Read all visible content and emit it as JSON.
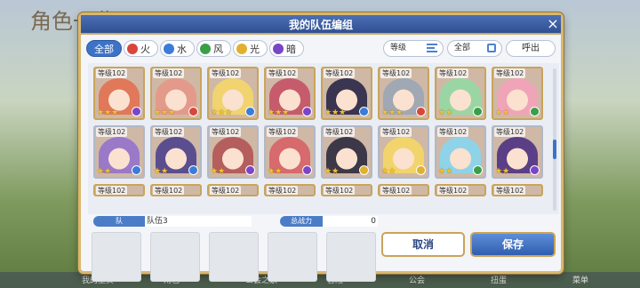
{
  "background": {
    "title": "角色一览",
    "bottom_nav": [
      "我的主页",
      "角色",
      "公会之家",
      "冒险",
      "公会",
      "扭蛋",
      "菜单"
    ]
  },
  "modal": {
    "title": "我的队伍编组",
    "close_symbol": "×"
  },
  "filters": {
    "elements": [
      {
        "label": "全部",
        "icon": "all",
        "color": "#3d73c7",
        "active": true
      },
      {
        "label": "火",
        "icon": "fire-icon",
        "color": "#d9463b",
        "active": false
      },
      {
        "label": "水",
        "icon": "water-icon",
        "color": "#3b7bd9",
        "active": false
      },
      {
        "label": "风",
        "icon": "wind-icon",
        "color": "#3a9f48",
        "active": false
      },
      {
        "label": "光",
        "icon": "light-icon",
        "color": "#e0b02f",
        "active": false
      },
      {
        "label": "暗",
        "icon": "dark-icon",
        "color": "#7b45c7",
        "active": false
      }
    ],
    "sort_label": "等级",
    "group_label": "全部",
    "call_label": "呼出"
  },
  "roster": {
    "rows": [
      [
        {
          "level": "等级102",
          "stars": "★★★",
          "elem_color": "#7b45c7",
          "hair": "#e1785a",
          "border": "gold"
        },
        {
          "level": "等级102",
          "stars": "★★★",
          "elem_color": "#d9463b",
          "hair": "#e39a8a",
          "border": "gold"
        },
        {
          "level": "等级102",
          "stars": "★★★",
          "elem_color": "#3b7bd9",
          "hair": "#f1d36f",
          "border": "gold"
        },
        {
          "level": "等级102",
          "stars": "★★★",
          "elem_color": "#7b45c7",
          "hair": "#c65c6b",
          "border": "gold"
        },
        {
          "level": "等级102",
          "stars": "★★★",
          "elem_color": "#3b7bd9",
          "hair": "#3a3550",
          "border": "gold"
        },
        {
          "level": "等级102",
          "stars": "★★★",
          "elem_color": "#d9463b",
          "hair": "#9fa8b3",
          "border": "gold"
        },
        {
          "level": "等级102",
          "stars": "★★",
          "elem_color": "#3a9f48",
          "hair": "#9ad6a3",
          "border": "gold"
        },
        {
          "level": "等级102",
          "stars": "★★",
          "elem_color": "#3a9f48",
          "hair": "#f0a4b8",
          "border": "gold"
        }
      ],
      [
        {
          "level": "等级102",
          "stars": "★★",
          "elem_color": "#3b7bd9",
          "hair": "#9b79c9",
          "border": "silver"
        },
        {
          "level": "等级102",
          "stars": "★★",
          "elem_color": "#3b7bd9",
          "hair": "#5b4e8f",
          "border": "silver"
        },
        {
          "level": "等级102",
          "stars": "★★",
          "elem_color": "#7b45c7",
          "hair": "#b55e5e",
          "border": "silver"
        },
        {
          "level": "等级102",
          "stars": "★★",
          "elem_color": "#7b45c7",
          "hair": "#d66a6d",
          "border": "silver"
        },
        {
          "level": "等级102",
          "stars": "★★",
          "elem_color": "#e0b02f",
          "hair": "#3c3848",
          "border": "silver"
        },
        {
          "level": "等级102",
          "stars": "★★",
          "elem_color": "#e0b02f",
          "hair": "#f2d46d",
          "border": "silver"
        },
        {
          "level": "等级102",
          "stars": "★★",
          "elem_color": "#3a9f48",
          "hair": "#8fd3e8",
          "border": "silver"
        },
        {
          "level": "等级102",
          "stars": "★★",
          "elem_color": "#7b45c7",
          "hair": "#5b3f86",
          "border": "silver"
        }
      ],
      [
        {
          "level": "等级102"
        },
        {
          "level": "等级102"
        },
        {
          "level": "等级102"
        },
        {
          "level": "等级102"
        },
        {
          "level": "等级102"
        },
        {
          "level": "等级102"
        },
        {
          "level": "等级102"
        },
        {
          "level": "等级102"
        }
      ]
    ]
  },
  "team": {
    "label": "队",
    "name": "队伍3",
    "power_label": "总战力",
    "power_value": "0"
  },
  "buttons": {
    "cancel": "取消",
    "save": "保存"
  }
}
